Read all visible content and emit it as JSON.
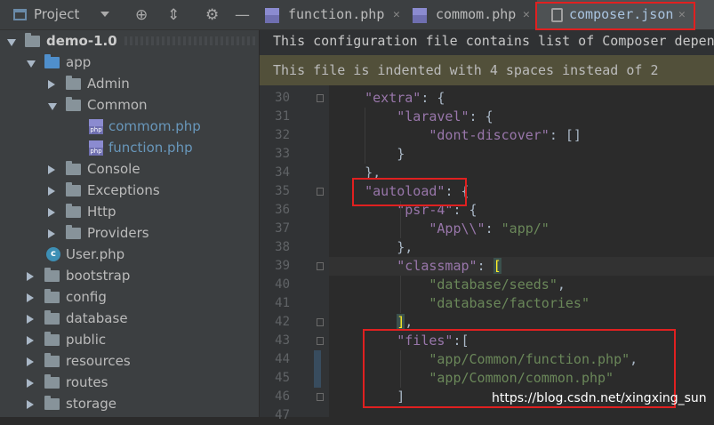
{
  "panel": {
    "title": "Project",
    "tree": [
      {
        "label": "demo-1.0",
        "type": "folder",
        "depth": 0,
        "expanded": true,
        "bold": true
      },
      {
        "label": "app",
        "type": "folder-blue",
        "depth": 1,
        "expanded": true
      },
      {
        "label": "Admin",
        "type": "folder",
        "depth": 2,
        "expanded": false
      },
      {
        "label": "Common",
        "type": "folder",
        "depth": 2,
        "expanded": true
      },
      {
        "label": "commom.php",
        "type": "php",
        "depth": 3
      },
      {
        "label": "function.php",
        "type": "php",
        "depth": 3
      },
      {
        "label": "Console",
        "type": "folder",
        "depth": 2,
        "expanded": false
      },
      {
        "label": "Exceptions",
        "type": "folder",
        "depth": 2,
        "expanded": false
      },
      {
        "label": "Http",
        "type": "folder",
        "depth": 2,
        "expanded": false
      },
      {
        "label": "Providers",
        "type": "folder",
        "depth": 2,
        "expanded": false
      },
      {
        "label": "User.php",
        "type": "class",
        "depth": 2
      },
      {
        "label": "bootstrap",
        "type": "folder",
        "depth": 1,
        "expanded": false
      },
      {
        "label": "config",
        "type": "folder",
        "depth": 1,
        "expanded": false
      },
      {
        "label": "database",
        "type": "folder",
        "depth": 1,
        "expanded": false
      },
      {
        "label": "public",
        "type": "folder",
        "depth": 1,
        "expanded": false
      },
      {
        "label": "resources",
        "type": "folder",
        "depth": 1,
        "expanded": false
      },
      {
        "label": "routes",
        "type": "folder",
        "depth": 1,
        "expanded": false
      },
      {
        "label": "storage",
        "type": "folder",
        "depth": 1,
        "expanded": false
      }
    ]
  },
  "tabs": [
    {
      "label": "function.php",
      "active": false
    },
    {
      "label": "commom.php",
      "active": false
    },
    {
      "label": "composer.json",
      "active": true
    }
  ],
  "info_bar": "This configuration file contains list of Composer depen",
  "indent_notice": "This file is indented with 4 spaces instead of 2",
  "code": {
    "line_numbers": [
      "30",
      "31",
      "32",
      "33",
      "34",
      "35",
      "36",
      "37",
      "38",
      "39",
      "40",
      "41",
      "42",
      "43",
      "44",
      "45",
      "46",
      "47"
    ],
    "lines": [
      [
        [
          "    ",
          ""
        ],
        [
          "\"extra\"",
          "k"
        ],
        [
          ": {",
          ""
        ]
      ],
      [
        [
          "        ",
          ""
        ],
        [
          "\"laravel\"",
          "k"
        ],
        [
          ": {",
          ""
        ]
      ],
      [
        [
          "            ",
          ""
        ],
        [
          "\"dont-discover\"",
          "k"
        ],
        [
          ": []",
          ""
        ]
      ],
      [
        [
          "        }",
          ""
        ]
      ],
      [
        [
          "    },",
          ""
        ]
      ],
      [
        [
          "    ",
          ""
        ],
        [
          "\"autoload\"",
          "k"
        ],
        [
          ": {",
          ""
        ]
      ],
      [
        [
          "        ",
          ""
        ],
        [
          "\"psr-4\"",
          "k"
        ],
        [
          ": {",
          ""
        ]
      ],
      [
        [
          "            ",
          ""
        ],
        [
          "\"App\\\\\"",
          "k"
        ],
        [
          ": ",
          ""
        ],
        [
          "\"app/\"",
          "s"
        ]
      ],
      [
        [
          "        },",
          ""
        ]
      ],
      [
        [
          "        ",
          ""
        ],
        [
          "\"classmap\"",
          "k"
        ],
        [
          ": ",
          ""
        ],
        [
          "[",
          "hb"
        ]
      ],
      [
        [
          "            ",
          ""
        ],
        [
          "\"database/seeds\"",
          "s"
        ],
        [
          ",",
          ""
        ]
      ],
      [
        [
          "            ",
          ""
        ],
        [
          "\"database/factories\"",
          "s"
        ]
      ],
      [
        [
          "        ",
          ""
        ],
        [
          "]",
          "hb"
        ],
        [
          ",",
          ""
        ]
      ],
      [
        [
          "        ",
          ""
        ],
        [
          "\"files\"",
          "k"
        ],
        [
          ":[",
          ""
        ]
      ],
      [
        [
          "            ",
          ""
        ],
        [
          "\"app/Common/function.php\"",
          "s"
        ],
        [
          ",",
          ""
        ]
      ],
      [
        [
          "            ",
          ""
        ],
        [
          "\"app/Common/common.php\"",
          "s"
        ]
      ],
      [
        [
          "        ]",
          ""
        ]
      ],
      [
        [
          "",
          ""
        ]
      ]
    ]
  },
  "watermark": "https://blog.csdn.net/xingxing_sun",
  "colors": {
    "annotation": "#e02020",
    "keyword": "#9876aa",
    "string": "#6a8759"
  }
}
